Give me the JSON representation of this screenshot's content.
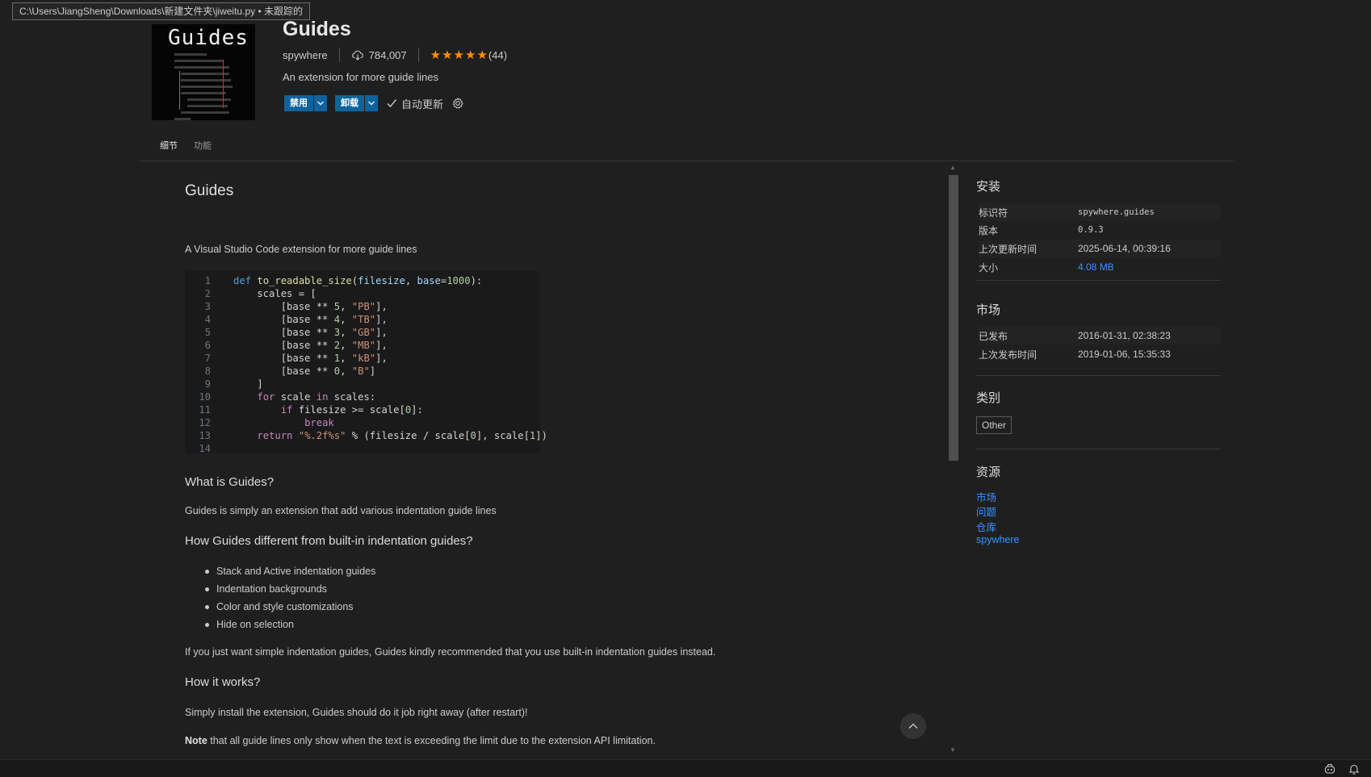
{
  "tooltip": {
    "text": "C:\\Users\\JiangSheng\\Downloads\\新建文件夹\\jiweitu.py • 未跟踪的"
  },
  "header": {
    "logo_text": "Guides",
    "name": "Guides",
    "publisher": "spywhere",
    "downloads": "784,007",
    "rating_count": "(44)",
    "rating": 5,
    "description": "An extension for more guide lines",
    "disable_label": "禁用",
    "uninstall_label": "卸载",
    "auto_update_label": "自动更新",
    "auto_update_checked": true
  },
  "tabs": [
    {
      "label": "细节",
      "active": true
    },
    {
      "label": "功能",
      "active": false
    }
  ],
  "readme": {
    "title": "Guides",
    "intro": "A Visual Studio Code extension for more guide lines",
    "code": [
      {
        "n": "1"
      },
      {
        "n": "2"
      },
      {
        "n": "3"
      },
      {
        "n": "4"
      },
      {
        "n": "5"
      },
      {
        "n": "6"
      },
      {
        "n": "7"
      },
      {
        "n": "8"
      },
      {
        "n": "9"
      },
      {
        "n": "10"
      },
      {
        "n": "11"
      },
      {
        "n": "12"
      },
      {
        "n": "13"
      },
      {
        "n": "14"
      }
    ],
    "code_text": [
      "def to_readable_size(filesize, base=1000):",
      "    scales = [",
      "        [base ** 5, \"PB\"],",
      "        [base ** 4, \"TB\"],",
      "        [base ** 3, \"GB\"],",
      "        [base ** 2, \"MB\"],",
      "        [base ** 1, \"kB\"],",
      "        [base ** 0, \"B\"]",
      "    ]",
      "    for scale in scales:",
      "        if filesize >= scale[0]:",
      "            break",
      "    return \"%.2f%s\" % (filesize / scale[0], scale[1])",
      ""
    ],
    "what_heading": "What is Guides?",
    "what_text": "Guides is simply an extension that add various indentation guide lines",
    "how_diff_heading": "How Guides different from built-in indentation guides?",
    "features": [
      "Stack and Active indentation guides",
      "Indentation backgrounds",
      "Color and style customizations",
      "Hide on selection"
    ],
    "recommend_text": "If you just want simple indentation guides, Guides kindly recommended that you use built-in indentation guides instead.",
    "how_works_heading": "How it works?",
    "how_works_text": "Simply install the extension, Guides should do it job right away (after restart)!",
    "note_label": "Note",
    "note_text": " that all guide lines only show when the text is exceeding the limit due to the extension API limitation."
  },
  "sidebar": {
    "install_heading": "安装",
    "identifier_label": "标识符",
    "identifier_value": "spywhere.guides",
    "version_label": "版本",
    "version_value": "0.9.3",
    "last_updated_label": "上次更新时间",
    "last_updated_value": "2025-06-14, 00:39:16",
    "size_label": "大小",
    "size_value": "4.08 MB",
    "market_heading": "市场",
    "published_label": "已发布",
    "published_value": "2016-01-31, 02:38:23",
    "last_released_label": "上次发布时间",
    "last_released_value": "2019-01-06, 15:35:33",
    "categories_heading": "类别",
    "category": "Other",
    "resources_heading": "资源",
    "resources": [
      "市场",
      "问题",
      "仓库",
      "spywhere"
    ]
  },
  "colors": {
    "accent": "#0e639c",
    "link": "#3794ff",
    "star": "#ff8e00",
    "background": "#1f1f1f"
  }
}
